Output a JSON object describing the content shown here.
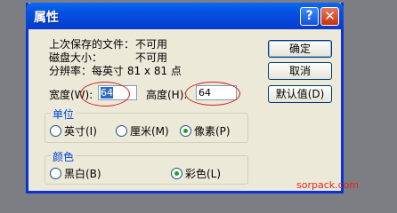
{
  "dialog": {
    "title": "属性",
    "help_label": "?",
    "close_label": "✕",
    "info": [
      {
        "label": "上次保存的文件：",
        "value": "不可用"
      },
      {
        "label": "磁盘大小：",
        "value": "不可用"
      },
      {
        "label": "分辨率：每英寸 81 x 81 点",
        "value": ""
      }
    ],
    "buttons": {
      "ok": "确定",
      "cancel": "取消",
      "default": "默认值(D)"
    },
    "width_label": "宽度(W):",
    "width_value": "64",
    "height_label": "高度(H):",
    "height_value": "64",
    "units": {
      "title": "单位",
      "options": [
        "英寸(I)",
        "厘米(M)",
        "像素(P)"
      ],
      "selected": "像素(P)"
    },
    "colors": {
      "title": "颜色",
      "options": [
        "黑白(B)",
        "彩色(L)"
      ],
      "selected": "彩色(L)"
    }
  },
  "watermark": "sorpack.com",
  "colors": {
    "accent": "#0a52e0",
    "annotation": "#d02020"
  }
}
